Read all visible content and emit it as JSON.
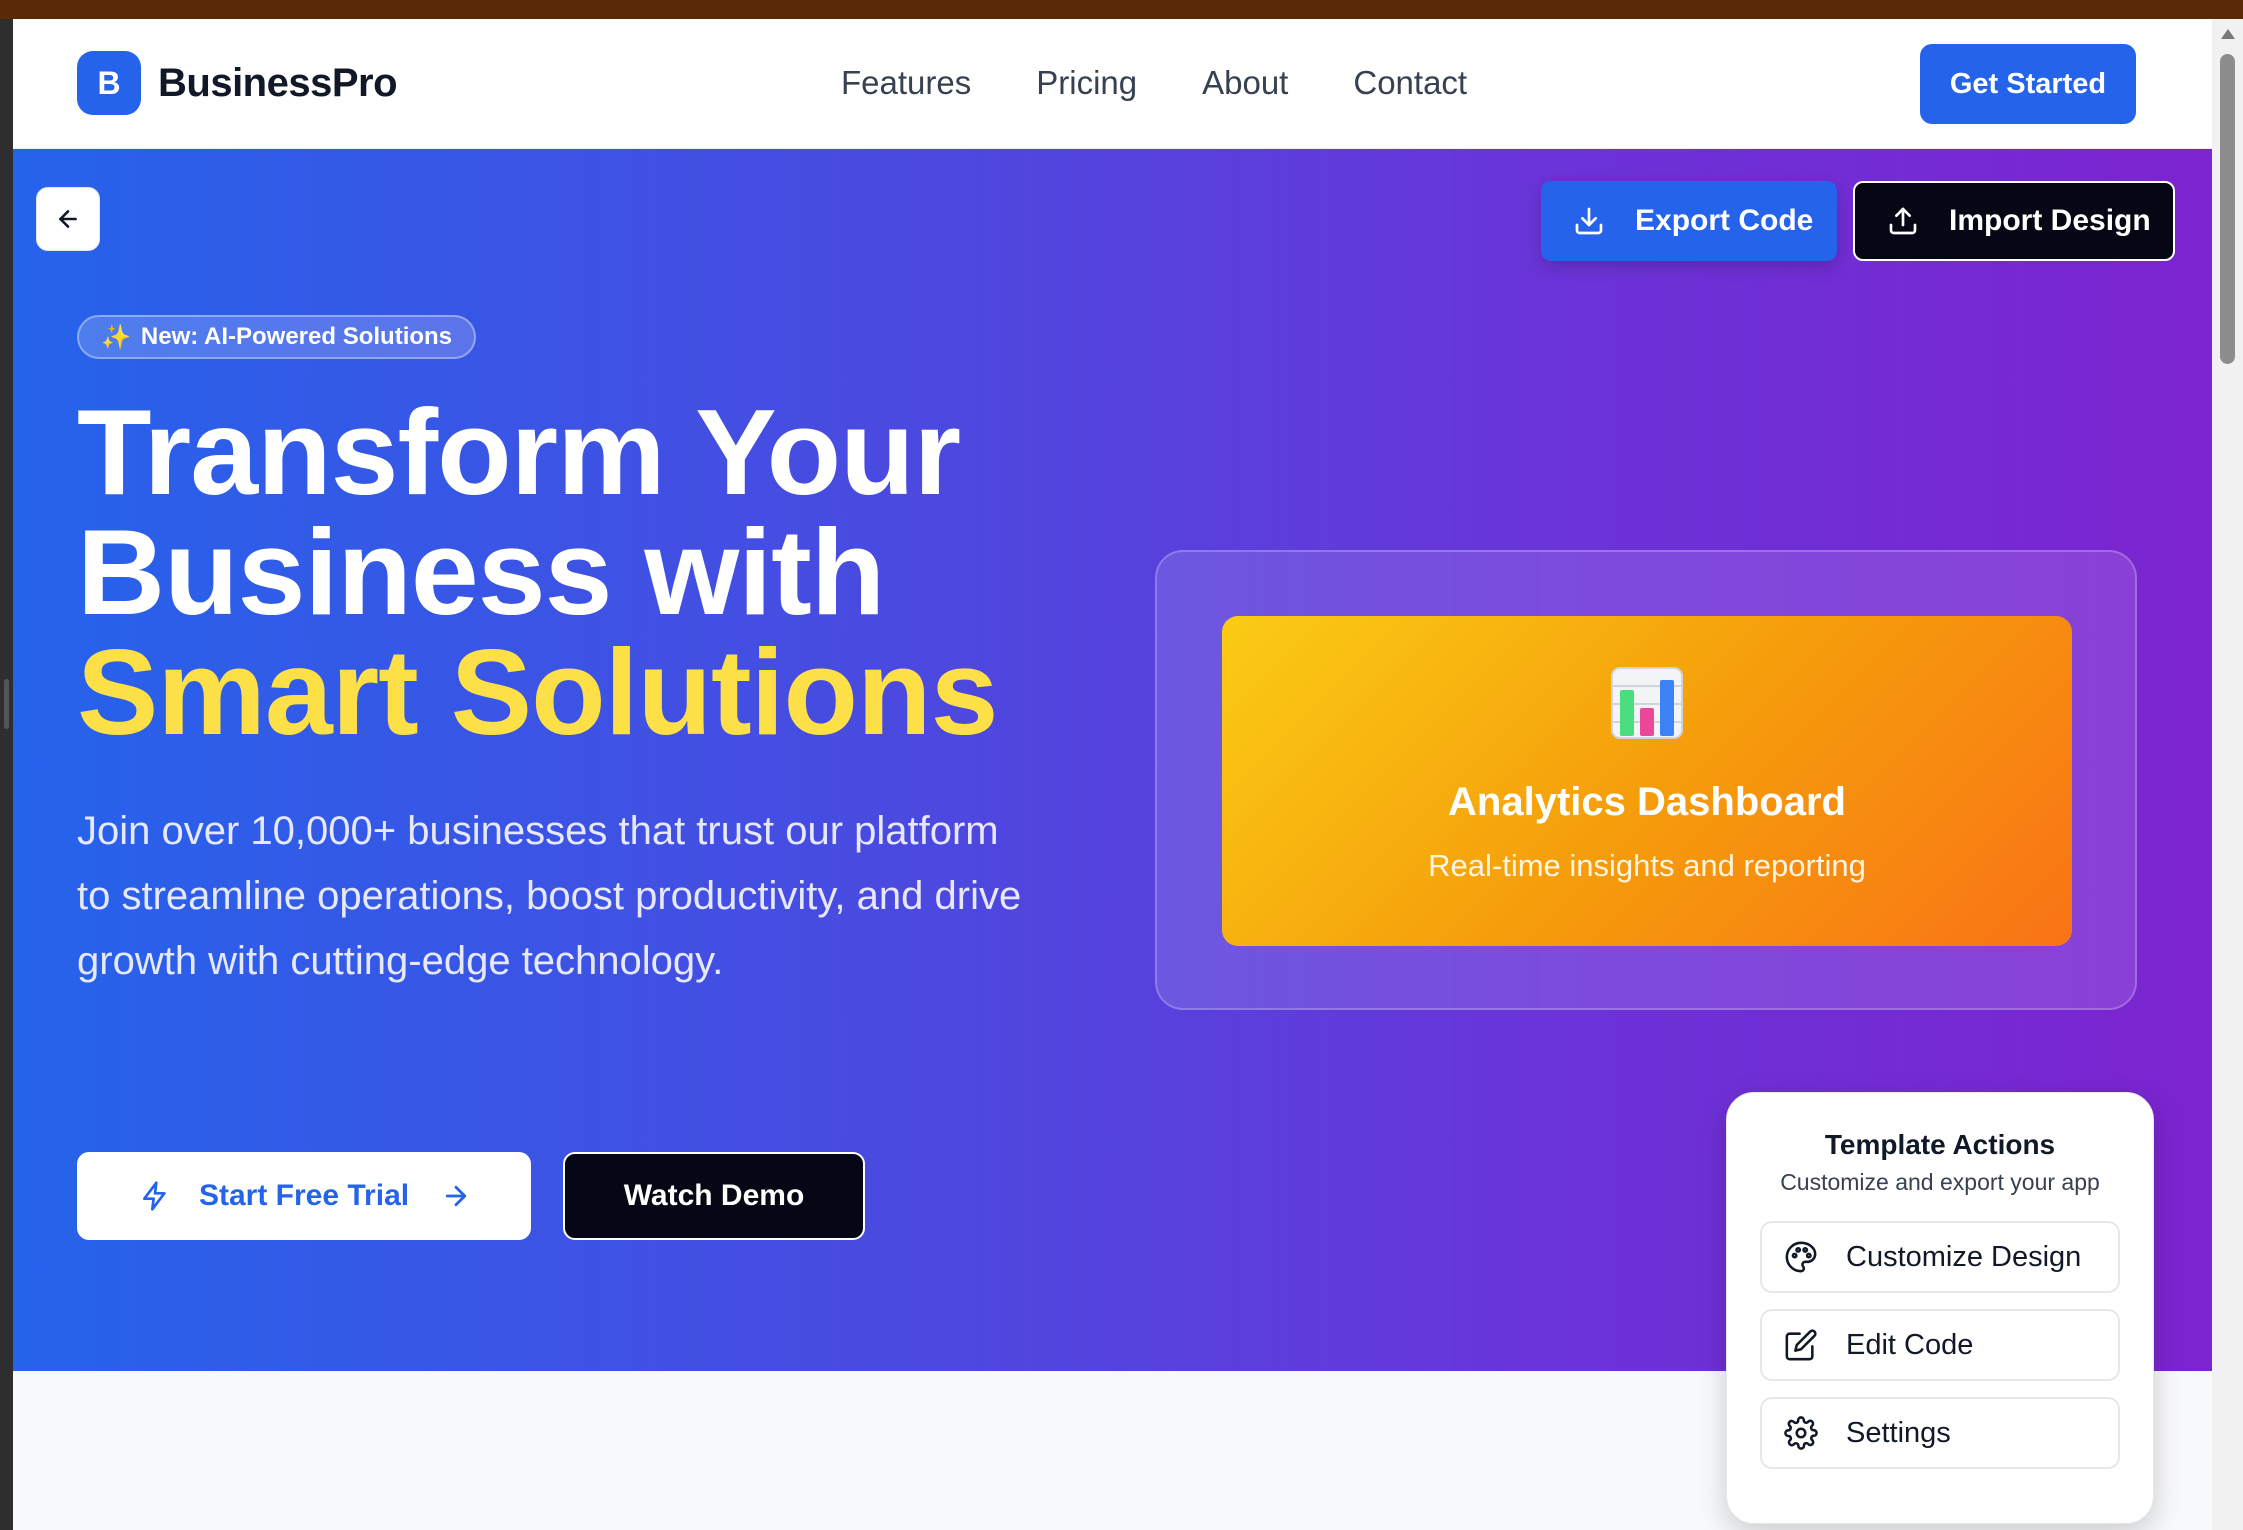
{
  "header": {
    "logo_letter": "B",
    "brand": "BusinessPro",
    "nav": [
      "Features",
      "Pricing",
      "About",
      "Contact"
    ],
    "cta": "Get Started"
  },
  "toolbar": {
    "export_label": "Export Code",
    "import_label": "Import Design"
  },
  "hero": {
    "badge_icon": "✨",
    "badge": "New: AI-Powered Solutions",
    "headline_line1": "Transform Your",
    "headline_line2": "Business with",
    "headline_accent": "Smart Solutions",
    "lead": "Join over 10,000+ businesses that trust our platform to streamline operations, boost productivity, and drive growth with cutting-edge technology.",
    "primary_cta": "Start Free Trial",
    "secondary_cta": "Watch Demo"
  },
  "feature_card": {
    "icon": "bar-chart-icon",
    "title": "Analytics Dashboard",
    "subtitle": "Real-time insights and reporting"
  },
  "template_actions": {
    "title": "Template Actions",
    "subtitle": "Customize and export your app",
    "buttons": [
      {
        "label": "Customize Design",
        "icon": "palette-icon"
      },
      {
        "label": "Edit Code",
        "icon": "edit-icon"
      },
      {
        "label": "Settings",
        "icon": "gear-icon"
      }
    ]
  },
  "colors": {
    "primary": "#2563eb",
    "accent_yellow": "#fde047",
    "gradient_end": "#7c24d0",
    "dark_button": "#050814"
  }
}
